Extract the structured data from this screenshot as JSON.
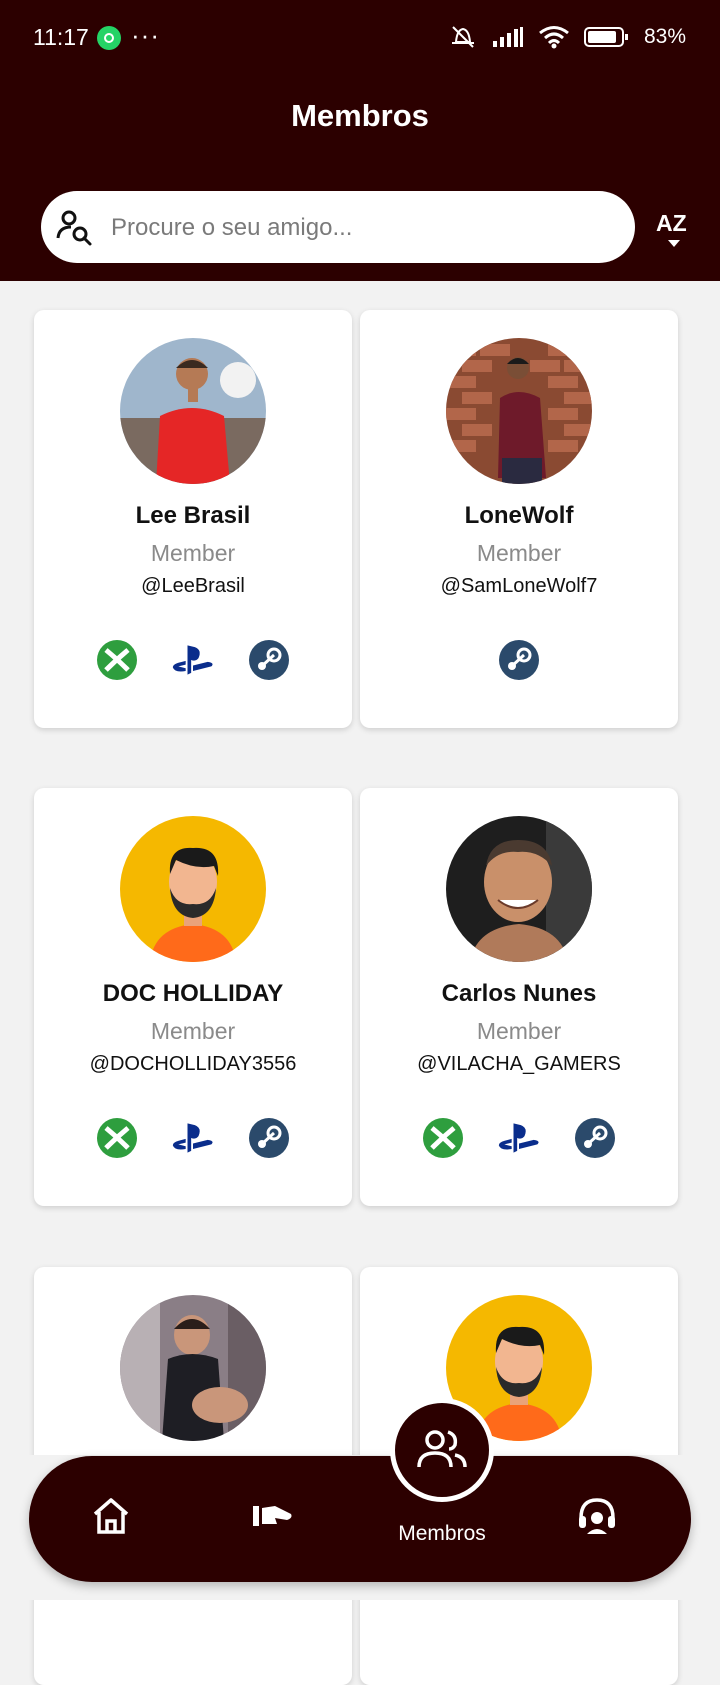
{
  "status_bar": {
    "time": "11:17",
    "battery": "83%"
  },
  "header": {
    "title": "Membros"
  },
  "search": {
    "placeholder": "Procure o seu amigo...",
    "value": ""
  },
  "sort": {
    "label": "AZ"
  },
  "members": [
    {
      "name": "Lee Brasil",
      "role": "Member",
      "handle": "@LeeBrasil",
      "avatar": "photo-man-red-shirt",
      "platforms": [
        "xbox",
        "playstation",
        "steam"
      ]
    },
    {
      "name": "LoneWolf",
      "role": "Member",
      "handle": "@SamLoneWolf7",
      "avatar": "photo-man-brick-wall",
      "platforms": [
        "steam"
      ]
    },
    {
      "name": "DOC HOLLIDAY",
      "role": "Member",
      "handle": "@DOCHOLLIDAY3556",
      "avatar": "default-avatar",
      "platforms": [
        "xbox",
        "playstation",
        "steam"
      ]
    },
    {
      "name": "Carlos Nunes",
      "role": "Member",
      "handle": "@VILACHA_GAMERS",
      "avatar": "photo-man-smiling",
      "platforms": [
        "xbox",
        "playstation",
        "steam"
      ]
    },
    {
      "name": "",
      "role": "",
      "handle": "",
      "avatar": "photo-man-gym",
      "platforms": []
    },
    {
      "name": "",
      "role": "",
      "handle": "",
      "avatar": "default-avatar",
      "platforms": []
    }
  ],
  "nav": {
    "items": [
      {
        "icon": "home-icon"
      },
      {
        "icon": "handshake-icon"
      },
      {
        "icon": "members-icon",
        "label": "Membros",
        "active": true
      },
      {
        "icon": "support-icon"
      }
    ]
  },
  "colors": {
    "primary": "#2c0000",
    "xbox": "#2e9e3e",
    "playstation": "#0a2d8c",
    "steam": "#2b4a6b",
    "default_avatar_bg": "#f5b800"
  }
}
